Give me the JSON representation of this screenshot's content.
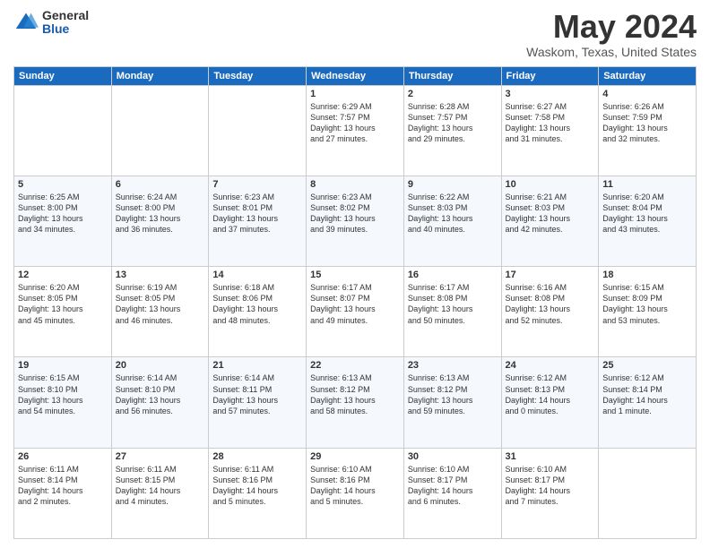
{
  "logo": {
    "general": "General",
    "blue": "Blue"
  },
  "title": {
    "month": "May 2024",
    "location": "Waskom, Texas, United States"
  },
  "weekdays": [
    "Sunday",
    "Monday",
    "Tuesday",
    "Wednesday",
    "Thursday",
    "Friday",
    "Saturday"
  ],
  "weeks": [
    [
      {
        "day": "",
        "info": ""
      },
      {
        "day": "",
        "info": ""
      },
      {
        "day": "",
        "info": ""
      },
      {
        "day": "1",
        "info": "Sunrise: 6:29 AM\nSunset: 7:57 PM\nDaylight: 13 hours\nand 27 minutes."
      },
      {
        "day": "2",
        "info": "Sunrise: 6:28 AM\nSunset: 7:57 PM\nDaylight: 13 hours\nand 29 minutes."
      },
      {
        "day": "3",
        "info": "Sunrise: 6:27 AM\nSunset: 7:58 PM\nDaylight: 13 hours\nand 31 minutes."
      },
      {
        "day": "4",
        "info": "Sunrise: 6:26 AM\nSunset: 7:59 PM\nDaylight: 13 hours\nand 32 minutes."
      }
    ],
    [
      {
        "day": "5",
        "info": "Sunrise: 6:25 AM\nSunset: 8:00 PM\nDaylight: 13 hours\nand 34 minutes."
      },
      {
        "day": "6",
        "info": "Sunrise: 6:24 AM\nSunset: 8:00 PM\nDaylight: 13 hours\nand 36 minutes."
      },
      {
        "day": "7",
        "info": "Sunrise: 6:23 AM\nSunset: 8:01 PM\nDaylight: 13 hours\nand 37 minutes."
      },
      {
        "day": "8",
        "info": "Sunrise: 6:23 AM\nSunset: 8:02 PM\nDaylight: 13 hours\nand 39 minutes."
      },
      {
        "day": "9",
        "info": "Sunrise: 6:22 AM\nSunset: 8:03 PM\nDaylight: 13 hours\nand 40 minutes."
      },
      {
        "day": "10",
        "info": "Sunrise: 6:21 AM\nSunset: 8:03 PM\nDaylight: 13 hours\nand 42 minutes."
      },
      {
        "day": "11",
        "info": "Sunrise: 6:20 AM\nSunset: 8:04 PM\nDaylight: 13 hours\nand 43 minutes."
      }
    ],
    [
      {
        "day": "12",
        "info": "Sunrise: 6:20 AM\nSunset: 8:05 PM\nDaylight: 13 hours\nand 45 minutes."
      },
      {
        "day": "13",
        "info": "Sunrise: 6:19 AM\nSunset: 8:05 PM\nDaylight: 13 hours\nand 46 minutes."
      },
      {
        "day": "14",
        "info": "Sunrise: 6:18 AM\nSunset: 8:06 PM\nDaylight: 13 hours\nand 48 minutes."
      },
      {
        "day": "15",
        "info": "Sunrise: 6:17 AM\nSunset: 8:07 PM\nDaylight: 13 hours\nand 49 minutes."
      },
      {
        "day": "16",
        "info": "Sunrise: 6:17 AM\nSunset: 8:08 PM\nDaylight: 13 hours\nand 50 minutes."
      },
      {
        "day": "17",
        "info": "Sunrise: 6:16 AM\nSunset: 8:08 PM\nDaylight: 13 hours\nand 52 minutes."
      },
      {
        "day": "18",
        "info": "Sunrise: 6:15 AM\nSunset: 8:09 PM\nDaylight: 13 hours\nand 53 minutes."
      }
    ],
    [
      {
        "day": "19",
        "info": "Sunrise: 6:15 AM\nSunset: 8:10 PM\nDaylight: 13 hours\nand 54 minutes."
      },
      {
        "day": "20",
        "info": "Sunrise: 6:14 AM\nSunset: 8:10 PM\nDaylight: 13 hours\nand 56 minutes."
      },
      {
        "day": "21",
        "info": "Sunrise: 6:14 AM\nSunset: 8:11 PM\nDaylight: 13 hours\nand 57 minutes."
      },
      {
        "day": "22",
        "info": "Sunrise: 6:13 AM\nSunset: 8:12 PM\nDaylight: 13 hours\nand 58 minutes."
      },
      {
        "day": "23",
        "info": "Sunrise: 6:13 AM\nSunset: 8:12 PM\nDaylight: 13 hours\nand 59 minutes."
      },
      {
        "day": "24",
        "info": "Sunrise: 6:12 AM\nSunset: 8:13 PM\nDaylight: 14 hours\nand 0 minutes."
      },
      {
        "day": "25",
        "info": "Sunrise: 6:12 AM\nSunset: 8:14 PM\nDaylight: 14 hours\nand 1 minute."
      }
    ],
    [
      {
        "day": "26",
        "info": "Sunrise: 6:11 AM\nSunset: 8:14 PM\nDaylight: 14 hours\nand 2 minutes."
      },
      {
        "day": "27",
        "info": "Sunrise: 6:11 AM\nSunset: 8:15 PM\nDaylight: 14 hours\nand 4 minutes."
      },
      {
        "day": "28",
        "info": "Sunrise: 6:11 AM\nSunset: 8:16 PM\nDaylight: 14 hours\nand 5 minutes."
      },
      {
        "day": "29",
        "info": "Sunrise: 6:10 AM\nSunset: 8:16 PM\nDaylight: 14 hours\nand 5 minutes."
      },
      {
        "day": "30",
        "info": "Sunrise: 6:10 AM\nSunset: 8:17 PM\nDaylight: 14 hours\nand 6 minutes."
      },
      {
        "day": "31",
        "info": "Sunrise: 6:10 AM\nSunset: 8:17 PM\nDaylight: 14 hours\nand 7 minutes."
      },
      {
        "day": "",
        "info": ""
      }
    ]
  ]
}
